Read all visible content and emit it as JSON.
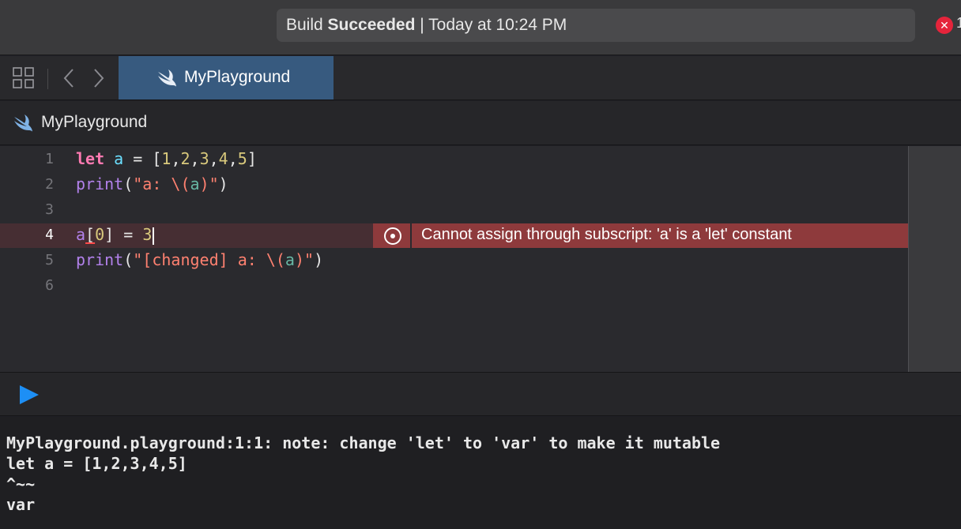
{
  "activity": {
    "prefix": "Build ",
    "status": "Succeeded",
    "suffix": " | Today at 10:24 PM",
    "error_count": "1"
  },
  "tabs": [
    {
      "label": "MyPlayground"
    }
  ],
  "breadcrumb": {
    "label": "MyPlayground"
  },
  "editor": {
    "line_numbers": [
      "1",
      "2",
      "3",
      "4",
      "5",
      "6"
    ],
    "active_line": "4",
    "lines": {
      "l1": {
        "kw": "let",
        "ident": "a",
        "eq": " = [",
        "n1": "1",
        "c1": ",",
        "n2": "2",
        "c2": ",",
        "n3": "3",
        "c3": ",",
        "n4": "4",
        "c4": ",",
        "n5": "5",
        "close": "]"
      },
      "l2": {
        "fn": "print",
        "p1": "(",
        "s1": "\"a: \\(",
        "ref": "a",
        "s2": ")\"",
        "p2": ")"
      },
      "l4": {
        "a": "a",
        "lb": "[",
        "idx": "0",
        "rest": "] = ",
        "val": "3"
      },
      "l5": {
        "fn": "print",
        "p1": "(",
        "s1": "\"[changed] a: \\(",
        "ref": "a",
        "s2": ")\"",
        "p2": ")"
      }
    },
    "error_message": "Cannot assign through subscript: 'a' is a 'let' constant"
  },
  "console": {
    "lines": [
      "MyPlayground.playground:1:1: note: change 'let' to 'var' to make it mutable",
      "let a = [1,2,3,4,5]",
      "^~~",
      "var"
    ]
  },
  "colors": {
    "keyword": "#ff7ab2",
    "identifier": "#6bdfff",
    "function": "#b281eb",
    "string": "#ff8170",
    "number": "#d9c97c",
    "error_bg": "#8e3a3c",
    "tab_active": "#375a7f",
    "run_button": "#1d8ff5"
  },
  "icons": [
    "grid-icon",
    "chevron-left-icon",
    "chevron-right-icon",
    "swift-icon",
    "error-icon",
    "play-icon"
  ]
}
